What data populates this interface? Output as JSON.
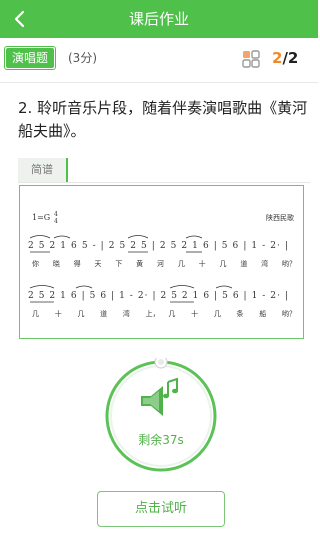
{
  "header": {
    "title": "课后作业"
  },
  "question_bar": {
    "type_label": "演唱题",
    "score_label": "(3分)",
    "progress_current": "2",
    "progress_sep": "/",
    "progress_total": "2"
  },
  "question": {
    "text": "2. 聆听音乐片段，随着伴奏演唱歌曲《黄河船夫曲》。"
  },
  "tabs": [
    {
      "label": "简谱"
    }
  ],
  "score": {
    "key": "1=G",
    "time_sig_top": "4",
    "time_sig_bottom": "4",
    "origin": "陕西民歌",
    "line1_notes": "2 5 2 1 6 5 - | 2 5 2 5 | 2 5 2 1 6 | 5 6 | 1 - 2· |",
    "line1_lyrics": [
      "你",
      "晓",
      "得",
      "天",
      "下",
      "黄",
      "河",
      "几",
      "十",
      "几",
      "道",
      "湾",
      "哟？"
    ],
    "line2_notes": "2 5 2 1 6 | 5 6 | 1 - 2· | 2 5 2 1 6 | 5 6 | 1 - 2· |",
    "line2_lyrics": [
      "几",
      "十",
      "几",
      "道",
      "湾",
      "上，",
      "几",
      "十",
      "几",
      "条",
      "船",
      "哟？"
    ]
  },
  "player": {
    "timer_label": "剩余37s"
  },
  "listen_button": {
    "label": "点击试听"
  },
  "colors": {
    "accent": "#4fc14a",
    "progress": "#f08a2a"
  }
}
